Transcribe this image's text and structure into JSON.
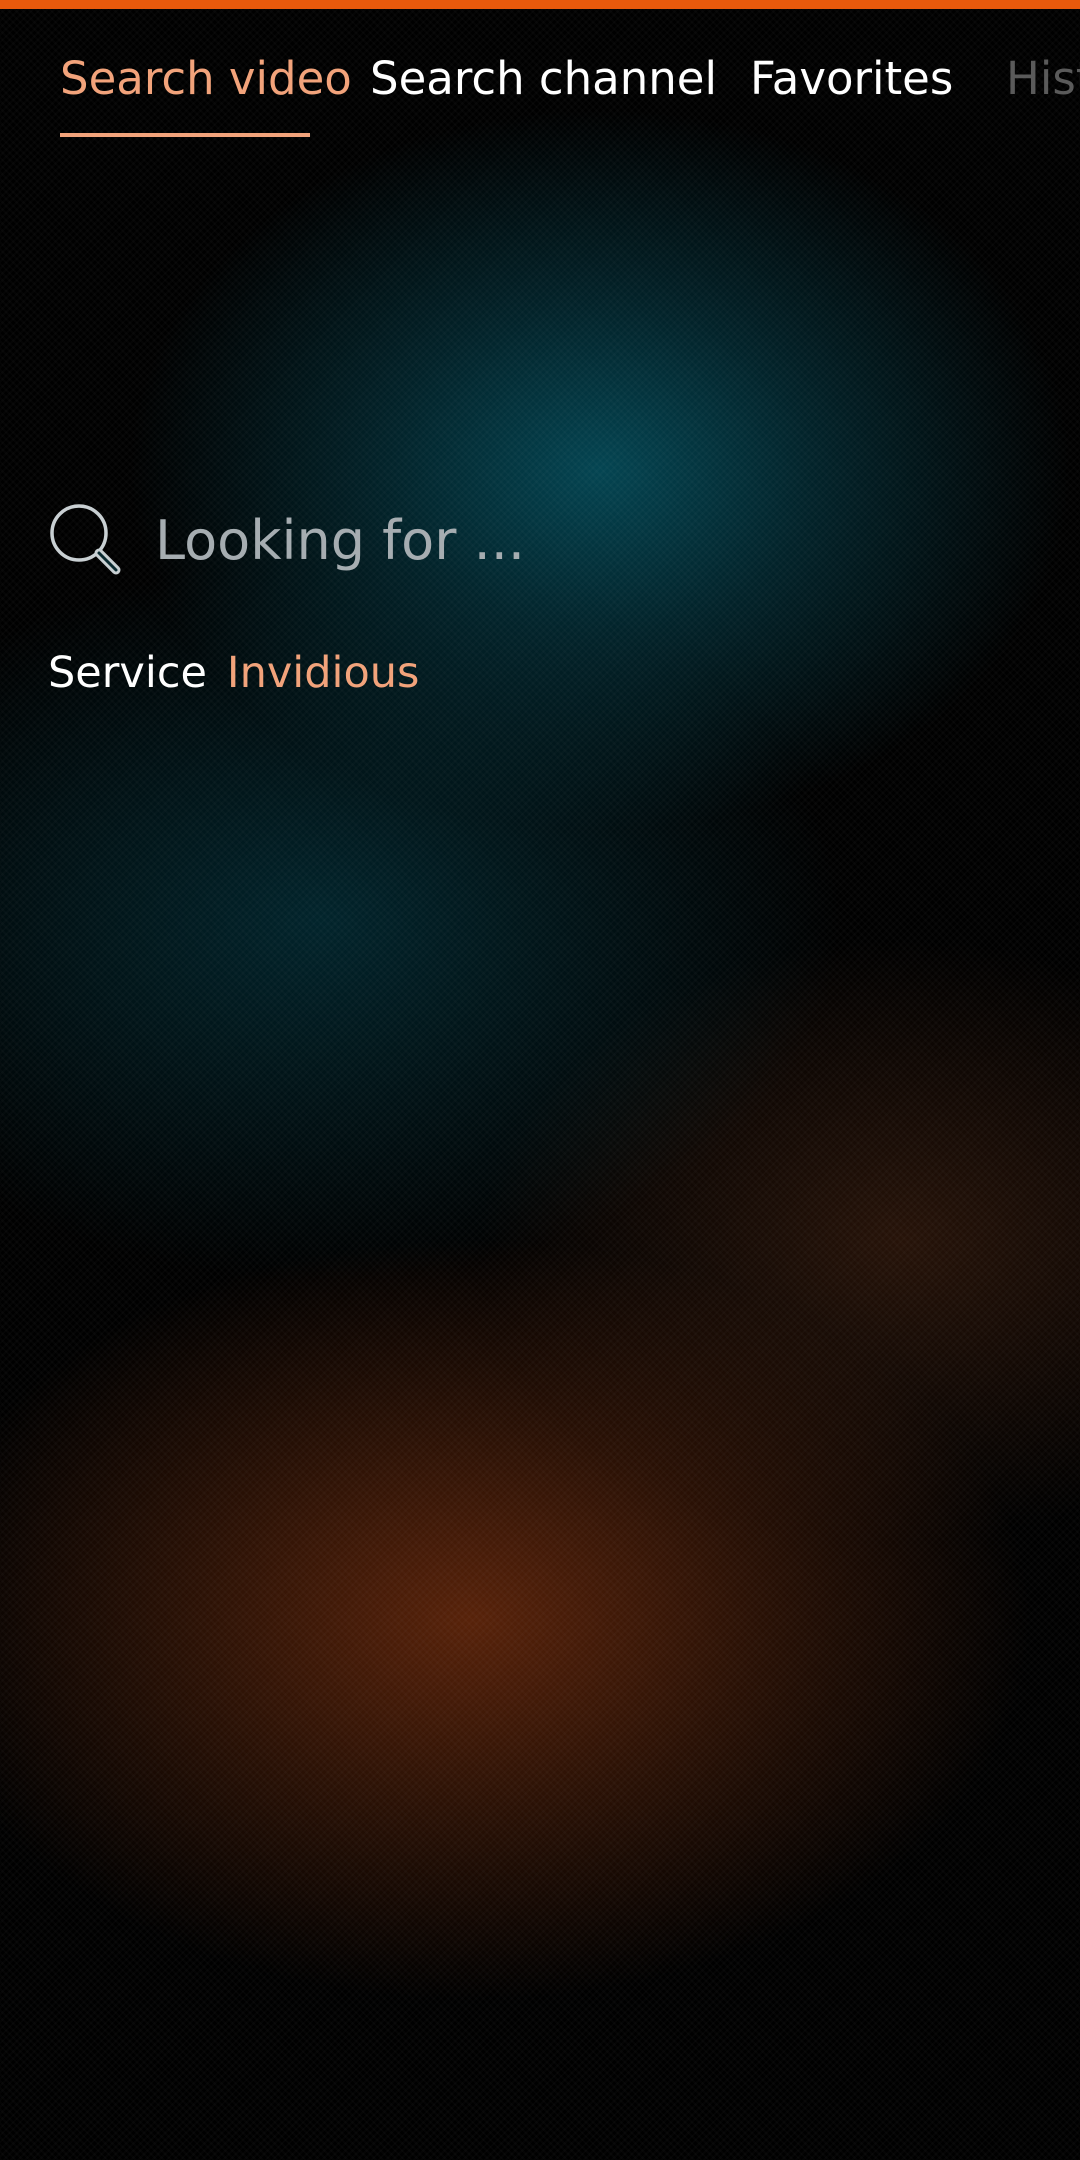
{
  "tabs": [
    {
      "label": "Search video",
      "active": true
    },
    {
      "label": "Search channel",
      "active": false
    },
    {
      "label": "Favorites",
      "active": false
    },
    {
      "label": "History",
      "active": false
    }
  ],
  "search": {
    "placeholder": "Looking for ...",
    "value": ""
  },
  "service": {
    "label": "Service",
    "value": "Invidious"
  },
  "icons": {
    "search": "search-icon"
  },
  "colors": {
    "accent": "#e8590c",
    "highlight": "#f2a37b",
    "text": "#ffffff",
    "placeholder": "#a6adb1"
  }
}
